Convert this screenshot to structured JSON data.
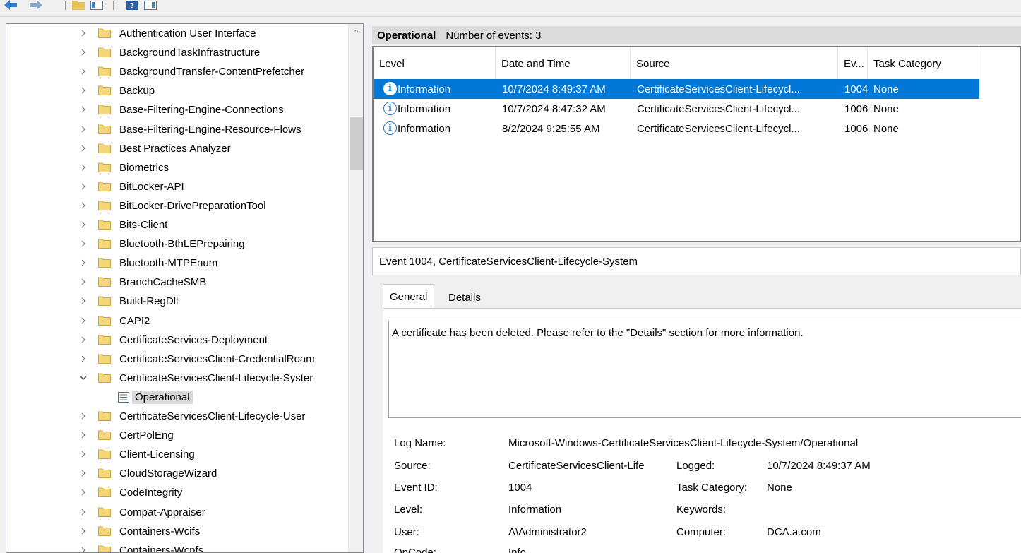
{
  "toolbar": {
    "buttons": [
      {
        "name": "back-button",
        "icon": "back-arrow-icon"
      },
      {
        "name": "forward-button",
        "icon": "forward-arrow-icon"
      },
      {
        "name": "up-button",
        "icon": "folder-up-icon"
      },
      {
        "name": "show-hide-tree-button",
        "icon": "console-tree-icon"
      },
      {
        "name": "help-button",
        "icon": "help-icon"
      },
      {
        "name": "show-hide-action-pane-button",
        "icon": "action-pane-icon"
      }
    ]
  },
  "tree": {
    "items": [
      {
        "label": "Authentication User Interface",
        "expanded": false
      },
      {
        "label": "BackgroundTaskInfrastructure",
        "expanded": false
      },
      {
        "label": "BackgroundTransfer-ContentPrefetcher",
        "expanded": false
      },
      {
        "label": "Backup",
        "expanded": false
      },
      {
        "label": "Base-Filtering-Engine-Connections",
        "expanded": false
      },
      {
        "label": "Base-Filtering-Engine-Resource-Flows",
        "expanded": false
      },
      {
        "label": "Best Practices Analyzer",
        "expanded": false
      },
      {
        "label": "Biometrics",
        "expanded": false
      },
      {
        "label": "BitLocker-API",
        "expanded": false
      },
      {
        "label": "BitLocker-DrivePreparationTool",
        "expanded": false
      },
      {
        "label": "Bits-Client",
        "expanded": false
      },
      {
        "label": "Bluetooth-BthLEPrepairing",
        "expanded": false
      },
      {
        "label": "Bluetooth-MTPEnum",
        "expanded": false
      },
      {
        "label": "BranchCacheSMB",
        "expanded": false
      },
      {
        "label": "Build-RegDll",
        "expanded": false
      },
      {
        "label": "CAPI2",
        "expanded": false
      },
      {
        "label": "CertificateServices-Deployment",
        "expanded": false
      },
      {
        "label": "CertificateServicesClient-CredentialRoam",
        "expanded": false
      },
      {
        "label": "CertificateServicesClient-Lifecycle-Syster",
        "expanded": true
      },
      {
        "label": "Operational",
        "child": true,
        "selected": true
      },
      {
        "label": "CertificateServicesClient-Lifecycle-User",
        "expanded": false
      },
      {
        "label": "CertPolEng",
        "expanded": false
      },
      {
        "label": "Client-Licensing",
        "expanded": false
      },
      {
        "label": "CloudStorageWizard",
        "expanded": false
      },
      {
        "label": "CodeIntegrity",
        "expanded": false
      },
      {
        "label": "Compat-Appraiser",
        "expanded": false
      },
      {
        "label": "Containers-Wcifs",
        "expanded": false
      },
      {
        "label": "Containers-Wcnfs",
        "expanded": false
      }
    ]
  },
  "events_header": {
    "title": "Operational",
    "count_text": "Number of events: 3"
  },
  "events_table": {
    "columns": [
      "Level",
      "Date and Time",
      "Source",
      "Ev...",
      "Task Category"
    ],
    "rows": [
      {
        "level": "Information",
        "datetime": "10/7/2024 8:49:37 AM",
        "source": "CertificateServicesClient-Lifecycl...",
        "event_id": "1004",
        "category": "None",
        "selected": true
      },
      {
        "level": "Information",
        "datetime": "10/7/2024 8:47:32 AM",
        "source": "CertificateServicesClient-Lifecycl...",
        "event_id": "1006",
        "category": "None",
        "selected": false
      },
      {
        "level": "Information",
        "datetime": "8/2/2024 9:25:55 AM",
        "source": "CertificateServicesClient-Lifecycl...",
        "event_id": "1006",
        "category": "None",
        "selected": false
      }
    ]
  },
  "detail": {
    "title": "Event 1004, CertificateServicesClient-Lifecycle-System",
    "tabs": [
      "General",
      "Details"
    ],
    "description": "A certificate has been deleted. Please refer to the \"Details\" section for more information.",
    "log_name_label": "Log Name:",
    "log_name_value": "Microsoft-Windows-CertificateServicesClient-Lifecycle-System/Operational",
    "source_label": "Source:",
    "source_value": "CertificateServicesClient-Life",
    "logged_label": "Logged:",
    "logged_value": "10/7/2024 8:49:37 AM",
    "event_id_label": "Event ID:",
    "event_id_value": "1004",
    "task_category_label": "Task Category:",
    "task_category_value": "None",
    "level_label": "Level:",
    "level_value": "Information",
    "keywords_label": "Keywords:",
    "keywords_value": "",
    "user_label": "User:",
    "user_value": "A\\Administrator2",
    "computer_label": "Computer:",
    "computer_value": "DCA.a.com",
    "opcode_label": "OpCode:",
    "opcode_value": "Info"
  },
  "colors": {
    "selection": "#0078d7",
    "folder": "#f5d77a",
    "info_icon": "#2a6fb5"
  }
}
